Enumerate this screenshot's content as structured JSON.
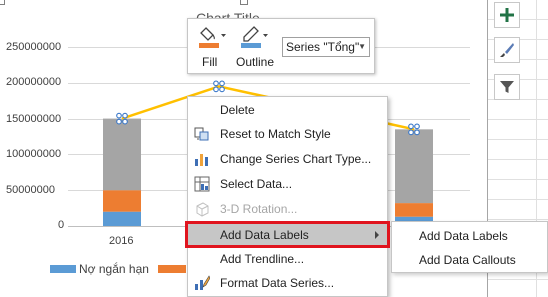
{
  "chart": {
    "title": "Chart Title",
    "y_ticks": [
      "250000000",
      "200000000",
      "150000000",
      "100000000",
      "50000000",
      "0"
    ],
    "x_ticks": [
      "2016"
    ],
    "legend": [
      "Nợ ngắn hạn"
    ]
  },
  "chart_data": {
    "type": "bar",
    "categories": [
      "2016",
      "",
      ""
    ],
    "ylim": [
      0,
      250000000
    ],
    "series": [
      {
        "name": "Nợ ngắn hạn",
        "values": [
          20000000,
          null,
          13000000
        ],
        "color": "#5b9bd5"
      },
      {
        "values": [
          30000000,
          null,
          19000000
        ],
        "color": "#ed7d31"
      },
      {
        "values": [
          100000000,
          null,
          103000000
        ],
        "color": "#a5a5a5"
      },
      {
        "name": "Tổng",
        "type": "line",
        "values": [
          150000000,
          195000000,
          135000000
        ],
        "color": "#ffc000"
      }
    ]
  },
  "mini_toolbar": {
    "fill_label": "Fill",
    "outline_label": "Outline",
    "series_select_value": "Series \"Tổng\""
  },
  "context_menu": {
    "items": [
      {
        "label": "Delete",
        "icon": "delete-icon",
        "enabled": true
      },
      {
        "label": "Reset to Match Style",
        "icon": "reset-style-icon",
        "enabled": true
      },
      {
        "label": "Change Series Chart Type...",
        "icon": "chart-type-icon",
        "enabled": true
      },
      {
        "label": "Select Data...",
        "icon": "select-data-icon",
        "enabled": true
      },
      {
        "label": "3-D Rotation...",
        "icon": "rotation-icon",
        "enabled": false
      },
      {
        "label": "Add Data Labels",
        "icon": "",
        "enabled": true,
        "submenu": true
      },
      {
        "label": "Add Trendline...",
        "icon": "",
        "enabled": true
      },
      {
        "label": "Format Data Series...",
        "icon": "format-series-icon",
        "enabled": true
      }
    ]
  },
  "submenu": {
    "items": [
      "Add Data Labels",
      "Add Data Callouts"
    ]
  },
  "colors": {
    "highlight": "#e0141e",
    "fill_swatch": "#ed7d31",
    "outline_swatch": "#5b9bd5"
  },
  "side_buttons": [
    "plus-icon",
    "brush-icon",
    "filter-icon"
  ]
}
